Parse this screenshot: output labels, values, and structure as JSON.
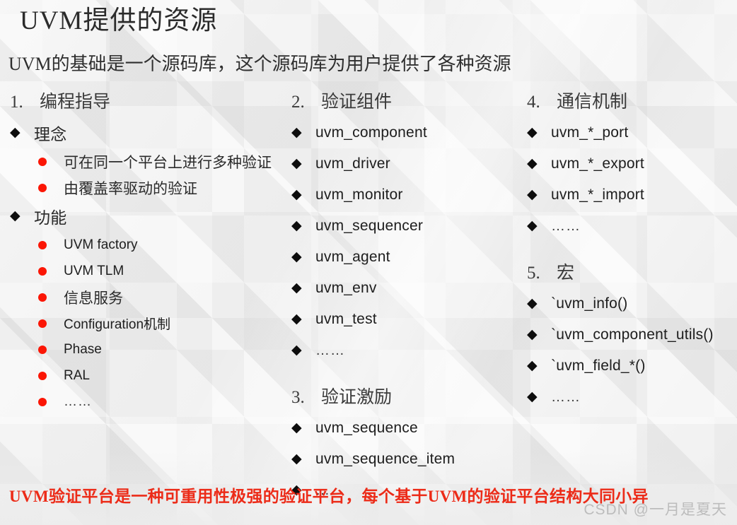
{
  "slide": {
    "title": "UVM提供的资源",
    "subtitle": "UVM的基础是一个源码库，这个源码库为用户提供了各种资源",
    "bottom_note": "UVM验证平台是一种可重用性极强的验证平台，每个基于UVM的验证平台结构大同小异",
    "watermark": "CSDN @一月是夏天",
    "colors": {
      "background": "#f1f1f1",
      "title_text": "#2b2b2b",
      "body_text": "#1d1d1d",
      "red_bullet": "#fb1605",
      "red_note": "#ec2b18",
      "diamond_bullet": "#0d0d0d"
    },
    "icons": {
      "diamond": "◆",
      "dot": "●"
    }
  },
  "columns": [
    {
      "id": "col-1",
      "sections": [
        {
          "number": "1.",
          "heading": "编程指导",
          "groups": [
            {
              "diamond": "理念",
              "diamond_cjk": true,
              "bullets": [
                {
                  "label": "可在同一个平台上进行多种验证",
                  "cjk": true
                },
                {
                  "label": "由覆盖率驱动的验证",
                  "cjk": true
                }
              ]
            },
            {
              "diamond": "功能",
              "diamond_cjk": true,
              "bullets": [
                {
                  "label": "UVM factory",
                  "cjk": false
                },
                {
                  "label": "UVM TLM",
                  "cjk": false
                },
                {
                  "label": "信息服务",
                  "cjk": true
                },
                {
                  "label": "Configuration机制",
                  "cjk": false
                },
                {
                  "label": "Phase",
                  "cjk": false
                },
                {
                  "label": "RAL",
                  "cjk": false
                },
                {
                  "label": "……",
                  "cjk": false,
                  "ellipsis": true
                }
              ]
            }
          ]
        }
      ]
    },
    {
      "id": "col-2",
      "sections": [
        {
          "number": "2.",
          "heading": "验证组件",
          "items": [
            {
              "label": "uvm_component"
            },
            {
              "label": "uvm_driver"
            },
            {
              "label": "uvm_monitor"
            },
            {
              "label": "uvm_sequencer"
            },
            {
              "label": "uvm_agent"
            },
            {
              "label": "uvm_env"
            },
            {
              "label": "uvm_test"
            },
            {
              "label": "……",
              "ellipsis": true
            }
          ]
        },
        {
          "number": "3.",
          "heading": "验证激励",
          "items": [
            {
              "label": "uvm_sequence"
            },
            {
              "label": "uvm_sequence_item"
            },
            {
              "label": "……",
              "ellipsis": true
            }
          ]
        }
      ]
    },
    {
      "id": "col-3",
      "sections": [
        {
          "number": "4.",
          "heading": "通信机制",
          "items": [
            {
              "label": "uvm_*_port"
            },
            {
              "label": "uvm_*_export"
            },
            {
              "label": "uvm_*_import"
            },
            {
              "label": "……",
              "ellipsis": true
            }
          ]
        },
        {
          "number": "5.",
          "heading": "宏",
          "items": [
            {
              "label": "`uvm_info()"
            },
            {
              "label": "`uvm_component_utils()"
            },
            {
              "label": "`uvm_field_*()"
            },
            {
              "label": "……",
              "ellipsis": true
            }
          ]
        }
      ]
    }
  ]
}
